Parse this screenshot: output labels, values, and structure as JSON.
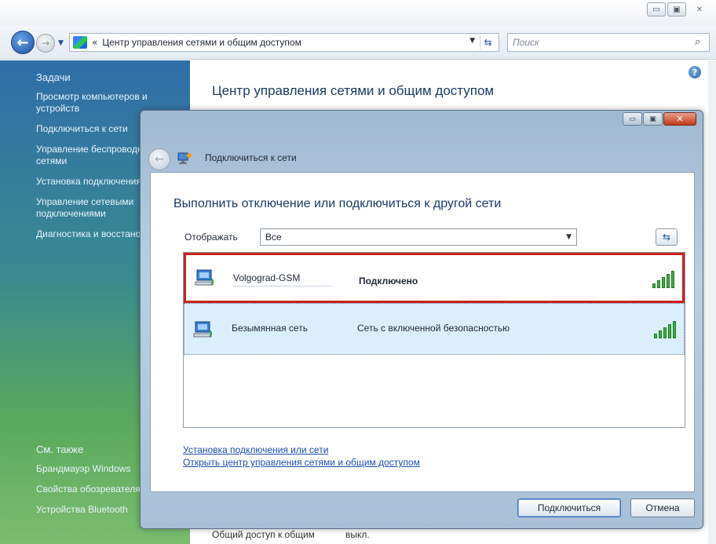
{
  "explorer": {
    "address_path": "Центр управления сетями и общим доступом",
    "address_chevron": "«",
    "search_placeholder": "Поиск",
    "window_buttons": {
      "minimize": "▭",
      "maximize": "▣",
      "close": "✕"
    },
    "sidebar": {
      "heading": "Задачи",
      "items": [
        "Просмотр компьютеров и устройств",
        "Подключиться к сети",
        "Управление беспроводными сетями",
        "Установка подключения или сети",
        "Управление сетевыми подключениями",
        "Диагностика и восстановление"
      ],
      "see_also_heading": "См. также",
      "see_also": [
        "Брандмауэр Windows",
        "Свойства обозревателя",
        "Устройства Bluetooth"
      ]
    },
    "content_title": "Центр управления сетями и общим доступом",
    "behind_row_label": "Общий доступ к общим",
    "behind_row_value": "выкл."
  },
  "dialog": {
    "title": "Подключиться к сети",
    "heading": "Выполнить отключение или подключиться к другой сети",
    "show_label": "Отображать",
    "show_value": "Все",
    "networks": [
      {
        "name": "Volgograd-GSM",
        "status": "Подключено",
        "signal": 5
      },
      {
        "name": "Безымянная сеть",
        "status": "Сеть с включенной безопасностью",
        "signal": 5
      }
    ],
    "links": [
      "Установка подключения или сети",
      "Открыть центр управления сетями и общим доступом"
    ],
    "connect_button": "Подключиться",
    "cancel_button": "Отмена"
  }
}
